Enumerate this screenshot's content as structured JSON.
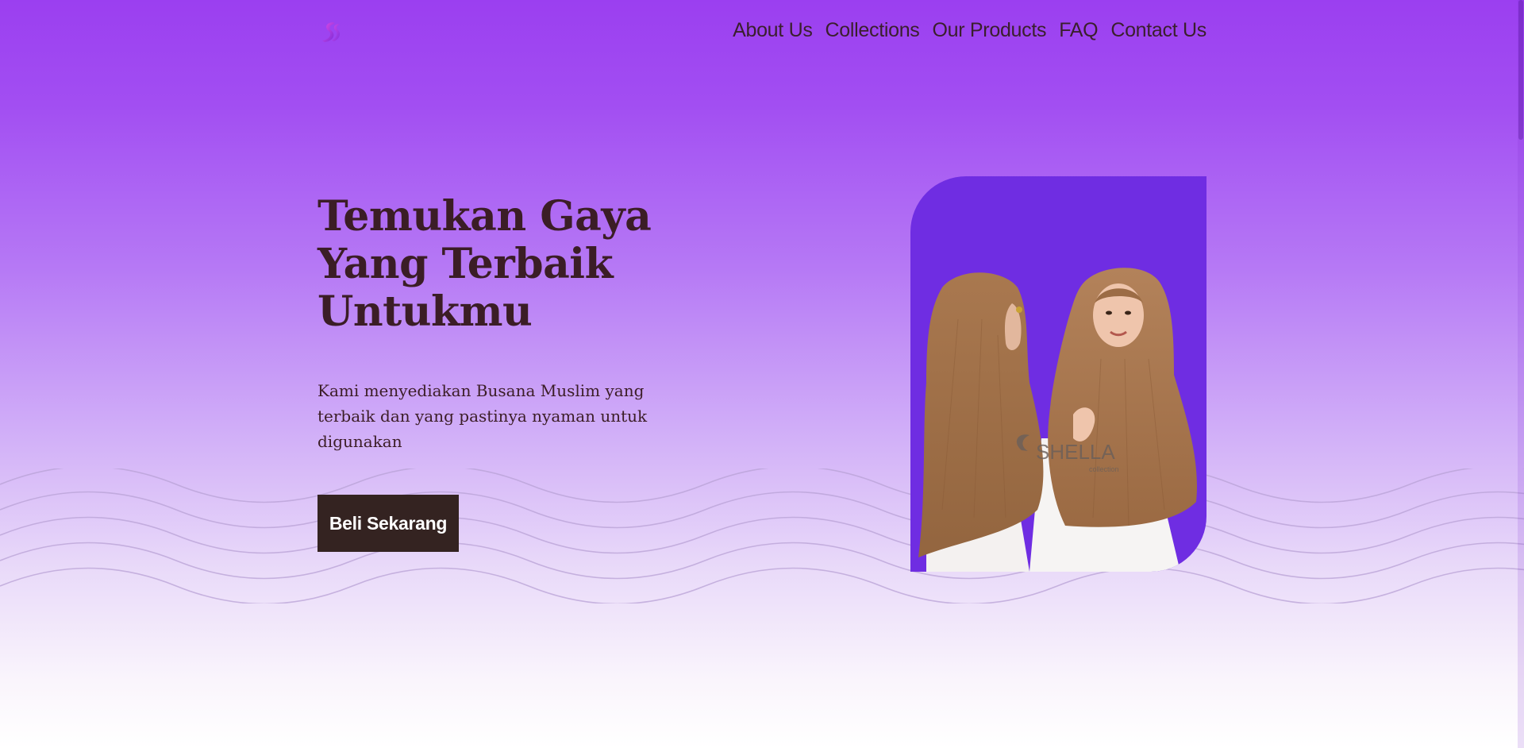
{
  "header": {
    "logo_icon": "swirl-s-logo-icon",
    "nav": [
      {
        "label": "About Us"
      },
      {
        "label": "Collections"
      },
      {
        "label": "Our Products"
      },
      {
        "label": "FAQ"
      },
      {
        "label": "Contact Us"
      }
    ]
  },
  "hero": {
    "title_lines": [
      "Temukan Gaya",
      "Yang Terbaik",
      "Untukmu"
    ],
    "subtitle_lines": [
      "Kami menyediakan Busana Muslim yang",
      "terbaik dan yang pastinya nyaman untuk",
      "digunakan"
    ],
    "cta_label": "Beli Sekarang",
    "image": {
      "description": "two models wearing brown hijabs",
      "brand_watermark": "SHELLA",
      "watermark_sub": "collection"
    }
  },
  "colors": {
    "brand_purple": "#9b3ff0",
    "image_bg": "#6f2de2",
    "text_dark": "#3b1d26",
    "button_bg": "#342321",
    "button_text": "#ffffff"
  }
}
